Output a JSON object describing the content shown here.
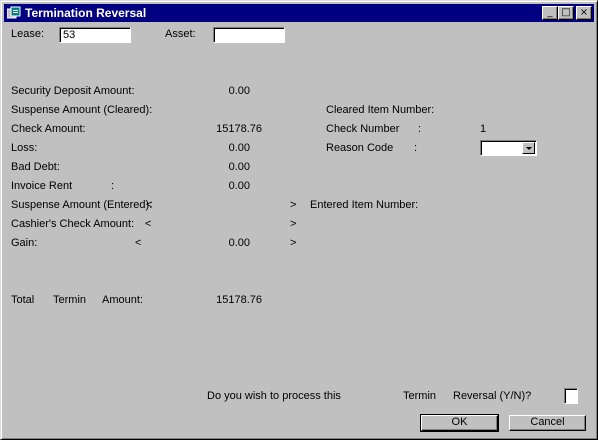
{
  "window": {
    "title": "Termination Reversal",
    "minimize_glyph": "_",
    "maximize_glyph": "□",
    "close_glyph": "×"
  },
  "header": {
    "lease_label": "Lease:",
    "lease_value": "53",
    "asset_label": "Asset:",
    "asset_value": ""
  },
  "left_fields": {
    "security_deposit": {
      "label": "Security Deposit Amount:",
      "value": "0.00"
    },
    "suspense_cleared": {
      "label": "Suspense Amount (Cleared):"
    },
    "check_amount": {
      "label": "Check Amount:",
      "value": "15178.76"
    },
    "loss": {
      "label": "Loss:",
      "value": "0.00"
    },
    "bad_debt": {
      "label": "Bad Debt:",
      "value": "0.00"
    },
    "invoice_rent": {
      "label": "Invoice Rent",
      "colon": ":",
      "value": "0.00"
    },
    "suspense_entered": {
      "label": "Suspense Amount (Entered):",
      "lt": "<",
      "gt": ">"
    },
    "cashiers_check": {
      "label": "Cashier's Check Amount:",
      "lt": "<",
      "gt": ">"
    },
    "gain": {
      "label": "Gain:",
      "lt": "<",
      "value": "0.00",
      "gt": ">"
    }
  },
  "right_fields": {
    "cleared_item_number": {
      "label": "Cleared Item Number:"
    },
    "check_number": {
      "label": "Check Number",
      "colon": ":",
      "value": "1"
    },
    "reason_code": {
      "label": "Reason Code",
      "colon": ":",
      "value": ""
    },
    "entered_item_number": {
      "label": "Entered Item Number:"
    }
  },
  "total": {
    "total_label": "Total",
    "termin_label": "Termin",
    "amount_label": "Amount:",
    "value": "15178.76"
  },
  "prompt": {
    "part1": "Do you wish to process this",
    "part2": "Termin",
    "part3": "Reversal (Y/N)?"
  },
  "buttons": {
    "ok": "OK",
    "cancel": "Cancel"
  },
  "colors": {
    "titlebar": "#000080",
    "face": "#c0c0c0"
  }
}
